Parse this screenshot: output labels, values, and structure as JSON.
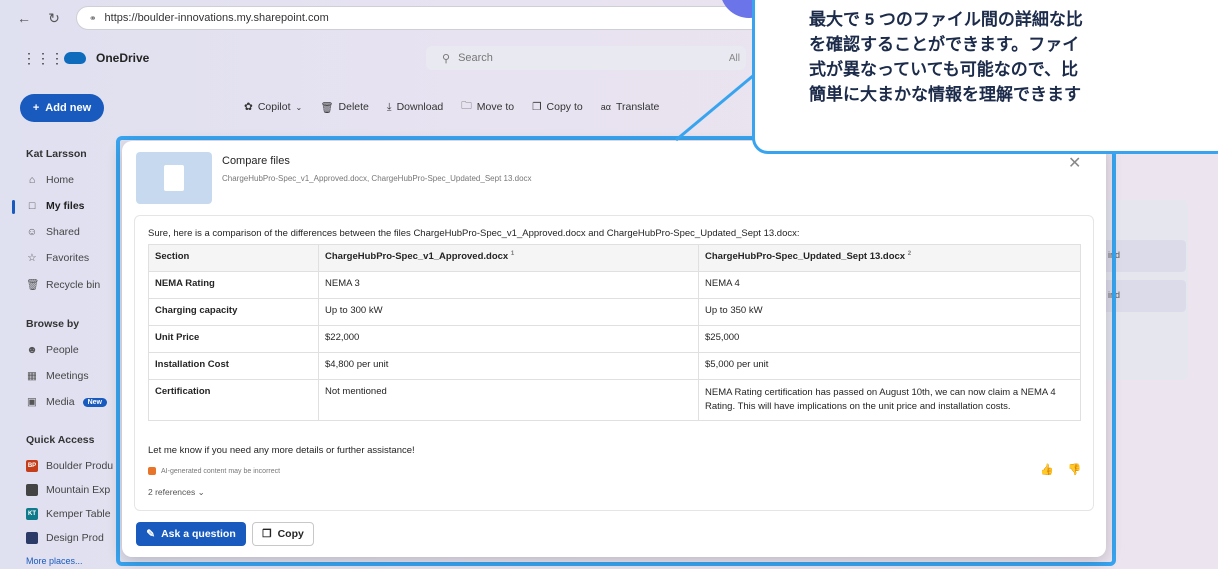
{
  "browser": {
    "url": "https://boulder-innovations.my.sharepoint.com"
  },
  "app": {
    "name": "OneDrive",
    "search_placeholder": "Search",
    "search_trailing": "All"
  },
  "sidebar": {
    "add_new": "Add new",
    "user": "Kat Larsson",
    "nav": [
      {
        "label": "Home",
        "icon": "home-icon"
      },
      {
        "label": "My files",
        "icon": "folder-icon"
      },
      {
        "label": "Shared",
        "icon": "people-icon"
      },
      {
        "label": "Favorites",
        "icon": "star-icon"
      },
      {
        "label": "Recycle bin",
        "icon": "trash-icon"
      }
    ],
    "browse_by": "Browse by",
    "browse": [
      {
        "label": "People",
        "icon": "person-icon"
      },
      {
        "label": "Meetings",
        "icon": "calendar-icon"
      },
      {
        "label": "Media",
        "icon": "image-icon",
        "badge": "New"
      }
    ],
    "quick_access": "Quick Access",
    "quick": [
      {
        "label": "Boulder Produ",
        "initials": "BP",
        "color": "#c43e1c"
      },
      {
        "label": "Mountain Exp",
        "initials": "",
        "color": "#444444"
      },
      {
        "label": "Kemper Table",
        "initials": "KT",
        "color": "#0f7b8a"
      },
      {
        "label": "Design Prod",
        "initials": "",
        "color": "#2b3a67"
      }
    ],
    "more_places": "More places..."
  },
  "toolbar": {
    "items": [
      "Copilot",
      "Delete",
      "Download",
      "Move to",
      "Copy to",
      "Translate"
    ]
  },
  "background_rows": [
    "ind",
    "ind"
  ],
  "modal": {
    "title": "Compare files",
    "subtitle": "ChargeHubPro-Spec_v1_Approved.docx, ChargeHubPro-Spec_Updated_Sept 13.docx",
    "intro": "Sure, here is a comparison of the differences between the files ChargeHubPro-Spec_v1_Approved.docx and ChargeHubPro-Spec_Updated_Sept 13.docx:",
    "table": {
      "headers": [
        "Section",
        "ChargeHubPro-Spec_v1_Approved.docx",
        "ChargeHubPro-Spec_Updated_Sept 13.docx"
      ],
      "header_refs": [
        "",
        "1",
        "2"
      ],
      "rows": [
        [
          "NEMA Rating",
          "NEMA 3",
          "NEMA 4"
        ],
        [
          "Charging capacity",
          "Up to 300 kW",
          "Up to 350 kW"
        ],
        [
          "Unit Price",
          "$22,000",
          "$25,000"
        ],
        [
          "Installation Cost",
          "$4,800 per unit",
          "$5,000 per unit"
        ],
        [
          "Certification",
          "Not mentioned",
          "NEMA Rating certification has passed on August 10th, we can now claim a NEMA 4 Rating. This will have implications on the unit price and installation costs."
        ]
      ]
    },
    "outro": "Let me know if you need any more details or further assistance!",
    "ai_note": "AI-generated content may be incorrect",
    "references": "2 references",
    "ask_button": "Ask a question",
    "copy_button": "Copy"
  },
  "callout": {
    "lines": [
      "最大で 5 つのファイル間の詳細な比",
      "を確認することができます。ファイ",
      "式が異なっていても可能なので、比",
      "簡単に大まかな情報を理解できます"
    ]
  },
  "colors": {
    "accent": "#185abd",
    "highlight": "#38a4f0",
    "step_circle": "#6b74e8"
  }
}
